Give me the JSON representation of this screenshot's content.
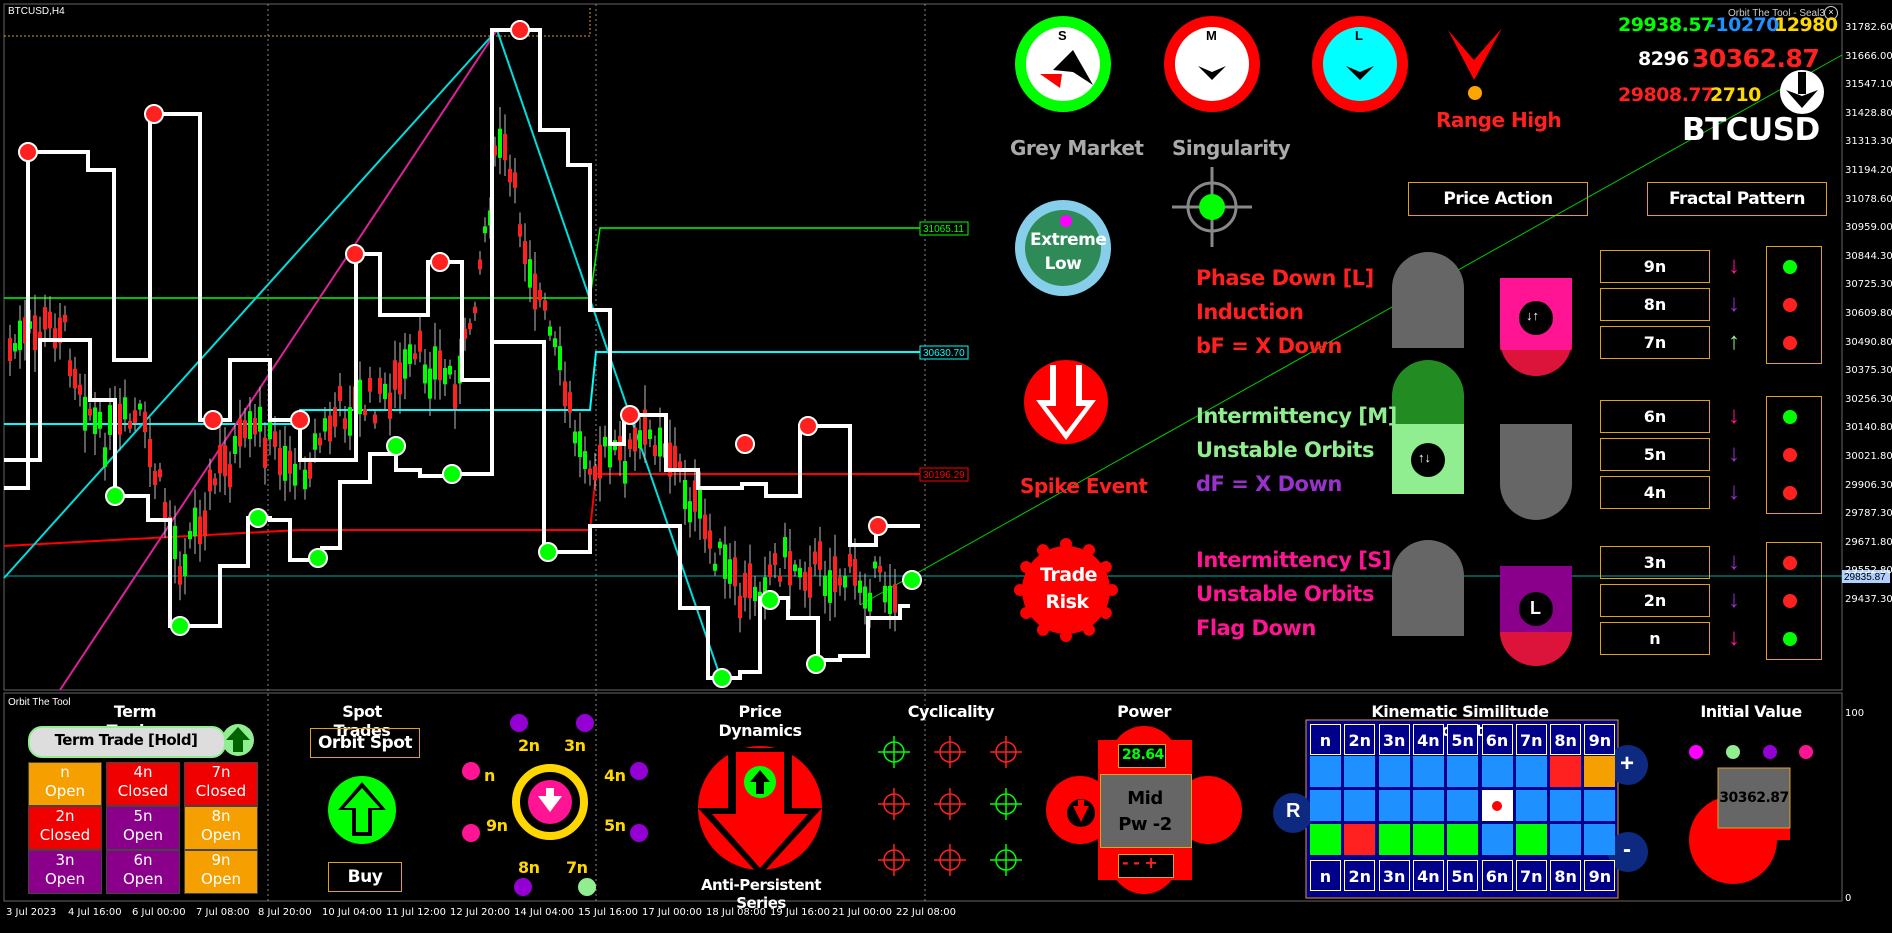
{
  "chart_header": {
    "symbol": "BTCUSD,H4",
    "indicator": "Orbit The Tool - Seal3",
    "subwindow_label": "Orbit The Tool"
  },
  "price_levels": {
    "green": "31065.11",
    "cyan": "30630.70",
    "red": "30196.29",
    "current": "29835.87"
  },
  "y_axis": [
    "31782.60",
    "31666.00",
    "31547.10",
    "31428.80",
    "31313.30",
    "31194.20",
    "31078.60",
    "30959.00",
    "30844.30",
    "30725.30",
    "30609.80",
    "30490.80",
    "30375.30",
    "30256.30",
    "30140.80",
    "30021.80",
    "29906.30",
    "29787.30",
    "29671.80",
    "29552.80",
    "29437.30"
  ],
  "y_axis_sub": [
    "100",
    "0"
  ],
  "x_axis": [
    "3 Jul 2023",
    "4 Jul 16:00",
    "6 Jul 00:00",
    "7 Jul 08:00",
    "8 Jul 20:00",
    "10 Jul 04:00",
    "11 Jul 12:00",
    "12 Jul 20:00",
    "14 Jul 04:00",
    "15 Jul 16:00",
    "17 Jul 00:00",
    "18 Jul 08:00",
    "19 Jul 16:00",
    "21 Jul 00:00",
    "22 Jul 08:00"
  ],
  "stats": {
    "v1": "29938.57",
    "v2": "-10270",
    "v3": "12980",
    "v4": "8296",
    "v5": "30362.87",
    "v6": "29808.77",
    "v7": "2710",
    "symbol": "BTCUSD"
  },
  "gauges": {
    "s": "S",
    "m": "M",
    "l": "L",
    "grey_market": "Grey Market",
    "singularity": "Singularity",
    "range_high": "Range High",
    "extreme_low": "Extreme Low",
    "spike_event": "Spike Event",
    "trade_risk": "Trade Risk"
  },
  "buttons": {
    "price_action": "Price Action",
    "fractal_pattern": "Fractal Pattern"
  },
  "phases": {
    "l1": "Phase Down [L]",
    "l2": "Induction",
    "l3": "bF = X Down",
    "m1": "Intermittency [M]",
    "m2": "Unstable Orbits",
    "m3": "dF = X Down",
    "s1": "Intermittency [S]",
    "s2": "Unstable Orbits",
    "s3": "Flag Down"
  },
  "pill_l": "L",
  "fractals": [
    "9n",
    "8n",
    "7n",
    "6n",
    "5n",
    "4n",
    "3n",
    "2n",
    "n"
  ],
  "term_trades": {
    "title": "Term Trades",
    "button": "Term Trade [Hold]",
    "cells": [
      {
        "n": "n",
        "s": "Open",
        "c": "#f5a000"
      },
      {
        "n": "4n",
        "s": "Closed",
        "c": "#f00000"
      },
      {
        "n": "7n",
        "s": "Closed",
        "c": "#f00000"
      },
      {
        "n": "2n",
        "s": "Closed",
        "c": "#f00000"
      },
      {
        "n": "5n",
        "s": "Open",
        "c": "#8b008b"
      },
      {
        "n": "8n",
        "s": "Open",
        "c": "#f5a000"
      },
      {
        "n": "3n",
        "s": "Open",
        "c": "#8b008b"
      },
      {
        "n": "6n",
        "s": "Open",
        "c": "#8b008b"
      },
      {
        "n": "9n",
        "s": "Open",
        "c": "#f5a000"
      }
    ]
  },
  "spot_trades": {
    "title": "Spot Trades",
    "button": "Orbit Spot",
    "action": "Buy"
  },
  "ring_labels": [
    "2n",
    "3n",
    "4n",
    "5n",
    "7n",
    "8n",
    "9n",
    "n"
  ],
  "price_dynamics": {
    "title": "Price Dynamics",
    "sub": "Anti-Persistent Series"
  },
  "cyclicality": {
    "title": "Cyclicality"
  },
  "power": {
    "title": "Power",
    "value": "28.64",
    "line1": "Mid",
    "line2": "Pw -2",
    "controls": "- - +"
  },
  "kso": {
    "title": "Kinematic Similitude Oscillator",
    "headers": [
      "n",
      "2n",
      "3n",
      "4n",
      "5n",
      "6n",
      "7n",
      "8n",
      "9n"
    ],
    "r": "R",
    "plus": "+",
    "minus": "-"
  },
  "initial_value": {
    "title": "Initial Value",
    "value": "30362.87"
  }
}
